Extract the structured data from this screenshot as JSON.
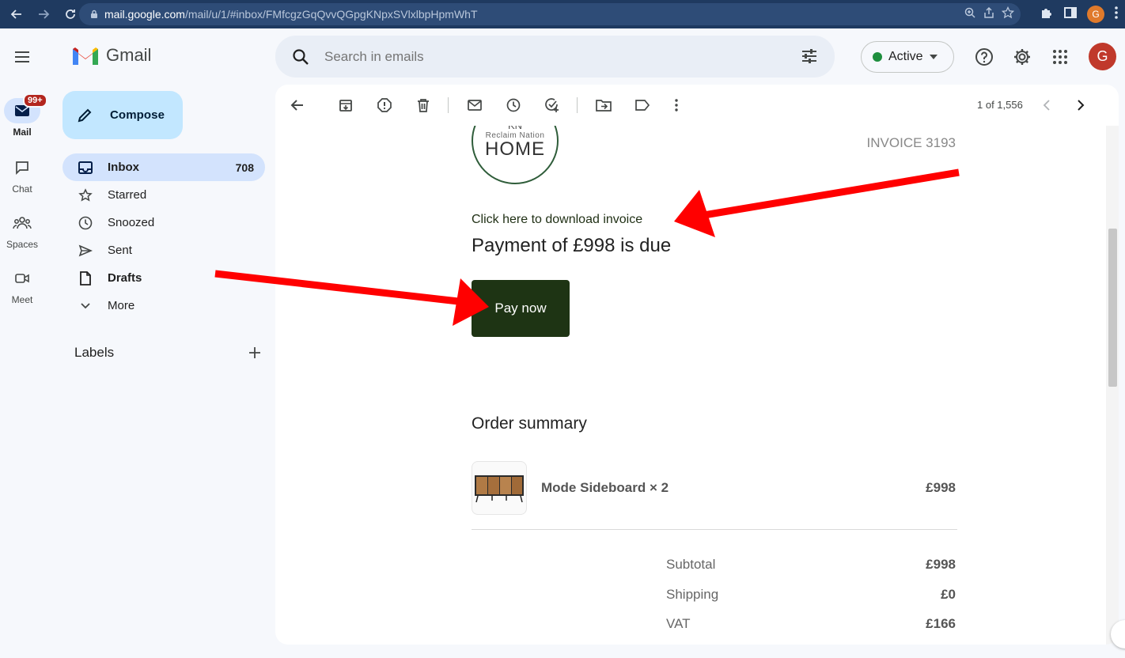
{
  "browser": {
    "url_host": "mail.google.com",
    "url_path": "/mail/u/1/#inbox/FMfcgzGqQvvQGpgKNpxSVlxlbpHpmWhT",
    "profile_initial": "G"
  },
  "rail": {
    "items": [
      {
        "label": "Mail",
        "badge": "99+"
      },
      {
        "label": "Chat"
      },
      {
        "label": "Spaces"
      },
      {
        "label": "Meet"
      }
    ]
  },
  "app": {
    "name": "Gmail"
  },
  "compose": {
    "label": "Compose"
  },
  "nav": {
    "items": [
      {
        "label": "Inbox",
        "count": "708"
      },
      {
        "label": "Starred"
      },
      {
        "label": "Snoozed"
      },
      {
        "label": "Sent"
      },
      {
        "label": "Drafts"
      },
      {
        "label": "More"
      }
    ],
    "labels_heading": "Labels"
  },
  "search": {
    "placeholder": "Search in emails"
  },
  "status": {
    "label": "Active",
    "color": "#1e8e3e"
  },
  "account": {
    "initial": "G"
  },
  "toolbar": {
    "pager": "1 of 1,556"
  },
  "email": {
    "brand": {
      "monogram": "KN",
      "name": "Reclaim Nation",
      "word": "HOME"
    },
    "invoice": "INVOICE 3193",
    "download_link": "Click here to download invoice",
    "due": "Payment of £998 is due",
    "pay_button": "Pay now",
    "summary_title": "Order summary",
    "item": {
      "name": "Mode Sideboard × 2",
      "price": "£998"
    },
    "totals": [
      {
        "label": "Subtotal",
        "value": "£998"
      },
      {
        "label": "Shipping",
        "value": "£0"
      },
      {
        "label": "VAT",
        "value": "£166"
      }
    ]
  },
  "colors": {
    "annotation_arrow": "#ff0000",
    "pay_button": "#1e3414"
  }
}
